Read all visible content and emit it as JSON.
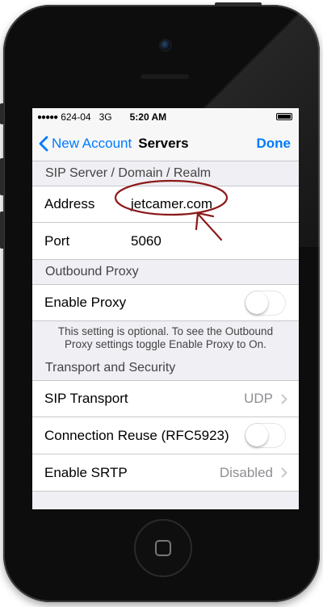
{
  "status_bar": {
    "signal_dots": "●●●●●",
    "carrier": "624-04",
    "network": "3G",
    "time": "5:20 AM"
  },
  "nav": {
    "back_label": "New Account",
    "title": "Servers",
    "done_label": "Done"
  },
  "sections": {
    "sip": {
      "header": "SIP Server / Domain / Realm",
      "address_label": "Address",
      "address_value": "jetcamer.com",
      "port_label": "Port",
      "port_value": "5060"
    },
    "proxy": {
      "header": "Outbound Proxy",
      "enable_label": "Enable Proxy",
      "enable_on": false,
      "footnote": "This setting is optional. To see the Outbound Proxy settings toggle Enable Proxy to On."
    },
    "transport": {
      "header": "Transport and Security",
      "sip_transport_label": "SIP Transport",
      "sip_transport_value": "UDP",
      "connection_reuse_label": "Connection Reuse (RFC5923)",
      "connection_reuse_on": false,
      "srtp_label": "Enable SRTP",
      "srtp_value": "Disabled"
    }
  },
  "colors": {
    "accent": "#007aff",
    "annotation": "#8b1a1a",
    "group_background": "#efeff4"
  },
  "icons": {
    "back": "chevron-left-icon",
    "disclosure": "chevron-right-icon",
    "home": "home-button-icon"
  }
}
